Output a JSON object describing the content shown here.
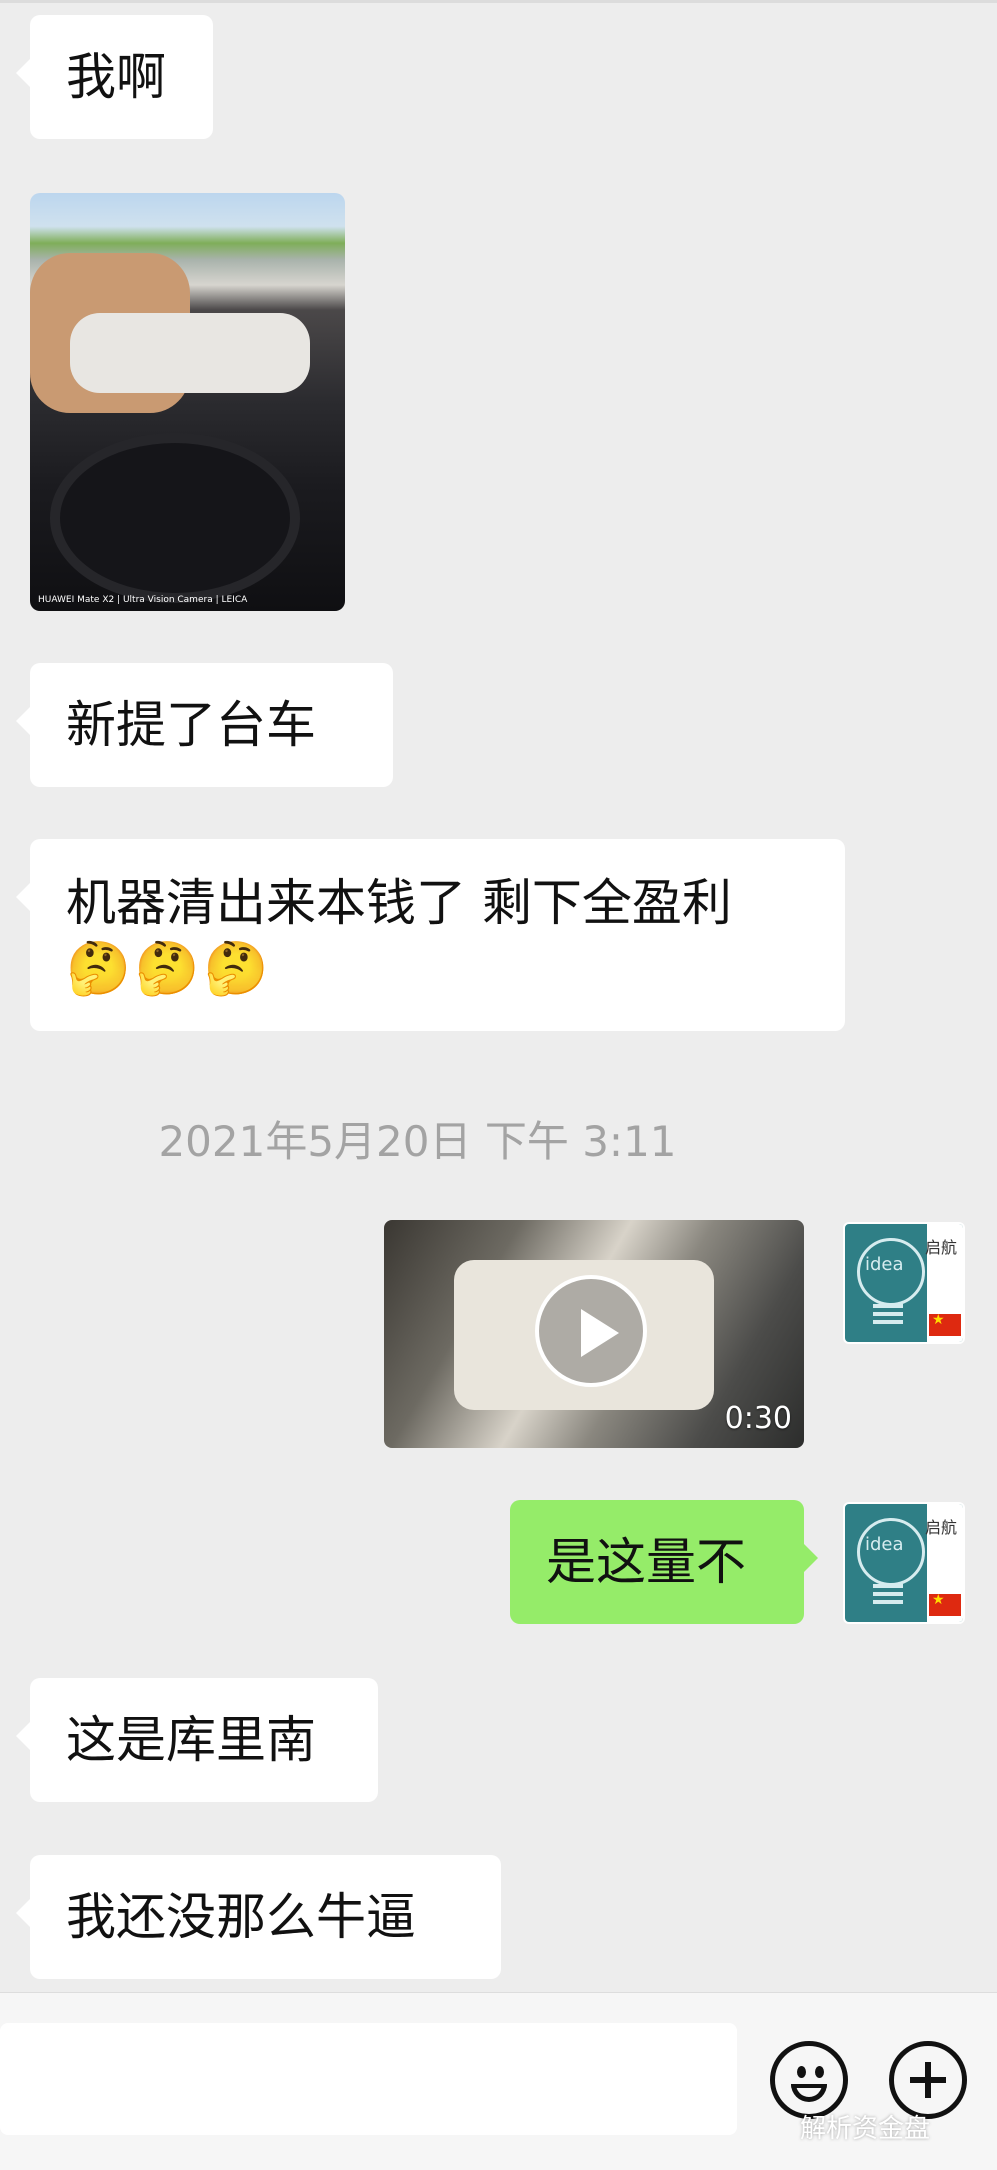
{
  "messages": {
    "m1": "我啊",
    "m3": "新提了台车",
    "m4": "机器清出来本钱了  剩下全盈利",
    "m4_emojis": "🤔🤔🤔",
    "m5": "是这量不",
    "m6": "这是库里南",
    "m7": "我还没那么牛逼"
  },
  "photo": {
    "caption": "HUAWEI Mate X2 | Ultra Vision Camera | LEICA"
  },
  "timestamp": "2021年5月20日 下午 3:11",
  "video": {
    "duration": "0:30"
  },
  "avatar": {
    "text": "idea",
    "side_label": "启航"
  },
  "watermark": "解析资金盘"
}
